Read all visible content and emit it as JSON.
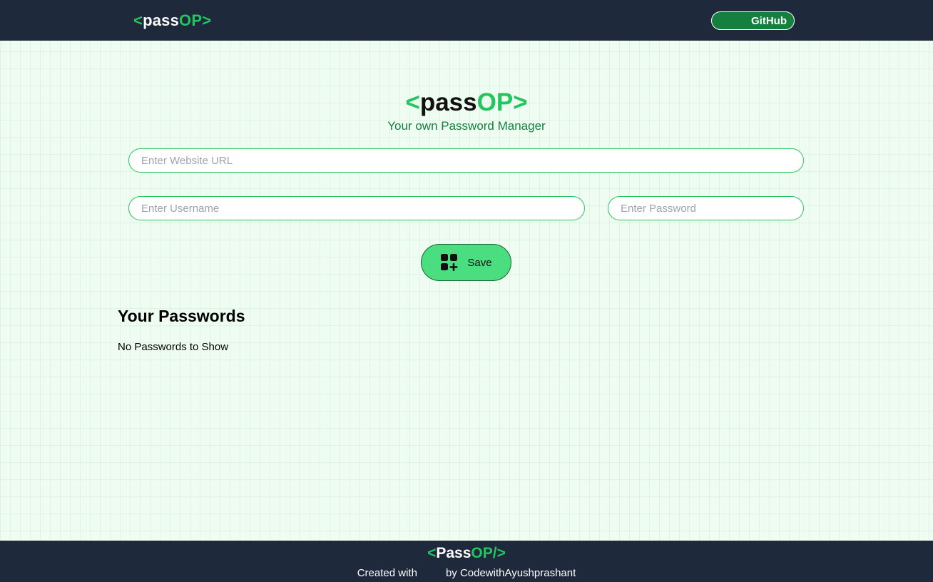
{
  "navbar": {
    "logo": {
      "open": "<",
      "mid": "pass",
      "accent": "OP",
      "close": ">"
    },
    "github_label": "GitHub"
  },
  "hero": {
    "logo": {
      "open": "<",
      "mid": "pass",
      "accent": "OP",
      "close": ">"
    },
    "tagline": "Your own Password Manager"
  },
  "form": {
    "url_placeholder": "Enter Website URL",
    "url_value": "",
    "username_placeholder": "Enter Username",
    "username_value": "",
    "password_placeholder": "Enter Password",
    "password_value": "",
    "save_label": "Save",
    "save_icon": "add-grid-icon"
  },
  "passwords": {
    "title": "Your Passwords",
    "empty_message": "No Passwords to Show"
  },
  "footer": {
    "logo": {
      "open": "<",
      "mid": "Pass",
      "accent": "OP/",
      "close": ">"
    },
    "credit_prefix": "Created with",
    "credit_suffix": "by CodewithAyushprashant"
  },
  "colors": {
    "accent": "#22c55e",
    "dark": "#1e293b",
    "save_bg": "#4ade80",
    "background": "#effcf1"
  }
}
